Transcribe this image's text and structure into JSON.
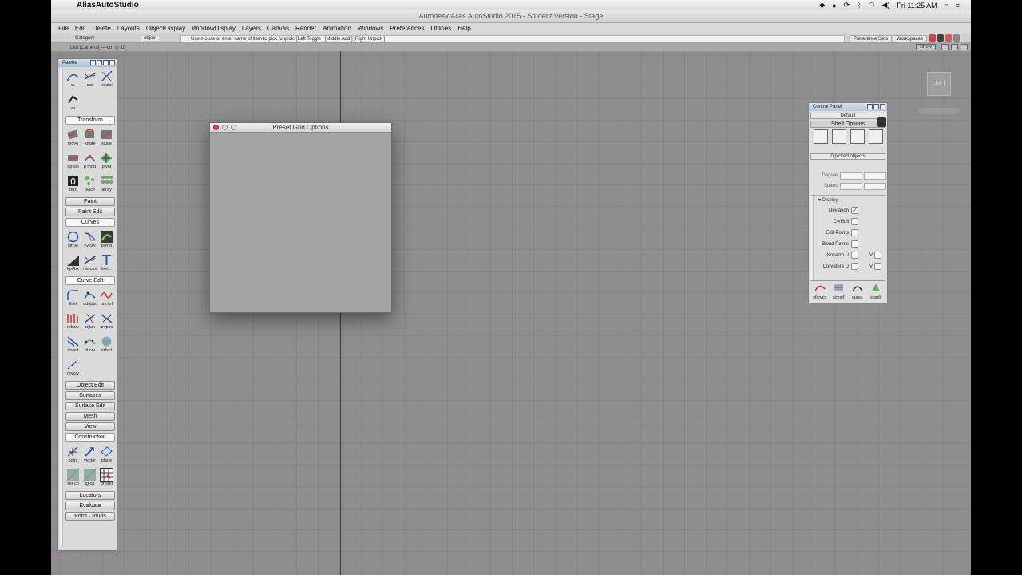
{
  "mac_menubar": {
    "app_name": "AliasAutoStudio",
    "clock": "Fri 11:25 AM"
  },
  "window": {
    "title": "Autodesk Alias AutoStudio 2015  - Student Version  - Stage"
  },
  "menu": [
    "File",
    "Edit",
    "Delete",
    "Layouts",
    "ObjectDisplay",
    "WindowDisplay",
    "Layers",
    "Canvas",
    "Render",
    "Animation",
    "Windows",
    "Preferences",
    "Utilities",
    "Help"
  ],
  "toolbar": {
    "category_label": "Category",
    "pick_mode": "object",
    "hint_text": "Use mouse or enter name of item to pick /unpick: [Left Toggle ] [Middle Add ] [Right Unpick ]",
    "preference_sets": "Preference Sets",
    "workspaces": "Workspaces"
  },
  "view": {
    "label": "Left [Camera] —-cm    ◎ 10",
    "show_button": "Show",
    "viewcube_face": "LEFT"
  },
  "palette": {
    "title": "Palette",
    "top_tools": [
      {
        "label": "cv",
        "icon": "cv-curve-icon"
      },
      {
        "label": "cos",
        "icon": "cos-icon"
      },
      {
        "label": "locator",
        "icon": "locator-icon"
      },
      {
        "label": "vis",
        "icon": "visibility-icon"
      }
    ],
    "transform": {
      "label": "Transform",
      "tools": [
        {
          "label": "move",
          "icon": "move-icon"
        },
        {
          "label": "rotate",
          "icon": "rotate-icon"
        },
        {
          "label": "scale",
          "icon": "scale-icon"
        },
        {
          "label": "np scl",
          "icon": "nonprop-scale-icon"
        },
        {
          "label": "p mod",
          "icon": "proportional-modify-icon"
        },
        {
          "label": "pivot",
          "icon": "pivot-icon"
        },
        {
          "label": "zero",
          "icon": "zero-transform-icon"
        },
        {
          "label": "place",
          "icon": "place-icon"
        },
        {
          "label": "array",
          "icon": "array-icon"
        }
      ]
    },
    "paint": "Paint",
    "paint_edit": "Paint Edit",
    "curves": {
      "label": "Curves",
      "tools": [
        {
          "label": "circle",
          "icon": "circle-icon"
        },
        {
          "label": "cv crv",
          "icon": "cv-curve-tool-icon"
        },
        {
          "label": "blend",
          "icon": "blend-curve-icon"
        },
        {
          "label": "kpt/bx",
          "icon": "keypoint-icon"
        },
        {
          "label": "nw cos",
          "icon": "new-cos-icon"
        },
        {
          "label": "text...",
          "icon": "text-icon"
        }
      ]
    },
    "curve_edit": {
      "label": "Curve Edit",
      "tools": [
        {
          "label": "fillet",
          "icon": "fillet-icon"
        },
        {
          "label": "addpts",
          "icon": "add-points-icon"
        },
        {
          "label": "brk inf",
          "icon": "break-inflection-icon"
        },
        {
          "label": "rebcrv",
          "icon": "rebuild-curve-icon"
        },
        {
          "label": "prjtan",
          "icon": "project-tangent-icon"
        },
        {
          "label": "crvplnr",
          "icon": "curve-planar-icon"
        },
        {
          "label": "crvsct",
          "icon": "curve-section-icon"
        },
        {
          "label": "fit crv",
          "icon": "fit-curve-icon"
        },
        {
          "label": "srfsct",
          "icon": "surface-section-icon"
        },
        {
          "label": "revcrv",
          "icon": "reverse-curve-icon"
        }
      ]
    },
    "collapsed_sections": [
      "Object Edit",
      "Surfaces",
      "Surface Edit",
      "Mesh",
      "View"
    ],
    "construction": {
      "label": "Construction",
      "tools": [
        {
          "label": "point",
          "icon": "construction-point-icon"
        },
        {
          "label": "vector",
          "icon": "vector-icon"
        },
        {
          "label": "plane",
          "icon": "plane-icon"
        },
        {
          "label": "set cp",
          "icon": "set-construction-plane-icon"
        },
        {
          "label": "tg cp",
          "icon": "toggle-construction-plane-icon"
        },
        {
          "label": "preset",
          "icon": "preset-grid-icon"
        }
      ]
    },
    "bottom_sections": [
      "Locators",
      "Evaluate",
      "Point Clouds"
    ]
  },
  "dialog": {
    "title": "Preset Grid Options"
  },
  "control_panel": {
    "title": "Control Panel",
    "preset": "Default",
    "shelf_options": "Shelf Options",
    "picked": "0 picked objects",
    "degree_label": "Degree",
    "spans_label": "Spans",
    "display_label": "Display",
    "checks": [
      {
        "label": "Deviation",
        "checked": true
      },
      {
        "label": "Cv/Hull",
        "checked": false
      },
      {
        "label": "Edit Points",
        "checked": false
      },
      {
        "label": "Blend Points",
        "checked": false
      },
      {
        "label": "Isoparm U",
        "checked": false,
        "v": "V"
      },
      {
        "label": "Curvature U",
        "checked": false,
        "v": "V"
      }
    ],
    "bottom_shelf": [
      {
        "label": "sfcrvcv",
        "icon": "surface-curve-icon"
      },
      {
        "label": "scnsrf",
        "icon": "scan-surface-icon"
      },
      {
        "label": "curva",
        "icon": "curvature-icon"
      },
      {
        "label": "xsedit",
        "icon": "cross-section-edit-icon"
      }
    ]
  },
  "colors": {
    "viewport_bg": "#8e8e8e",
    "grid_line": "#858585",
    "close_red": "#e2453c"
  }
}
